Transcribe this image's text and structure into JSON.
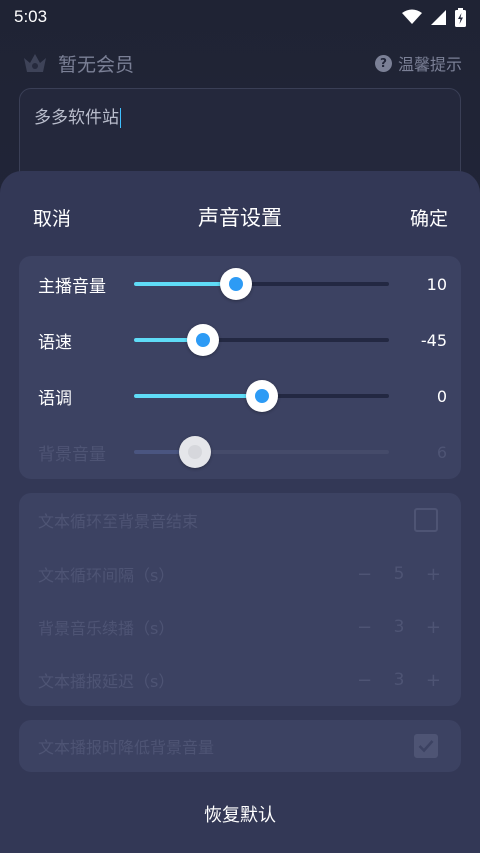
{
  "status_bar": {
    "time": "5:03"
  },
  "background": {
    "vip_label": "暂无会员",
    "tip_label": "温馨提示",
    "text_content": "多多软件站"
  },
  "sheet": {
    "cancel": "取消",
    "title": "声音设置",
    "confirm": "确定",
    "sliders": [
      {
        "label": "主播音量",
        "value_text": "10",
        "fraction": 0.4,
        "enabled": true
      },
      {
        "label": "语速",
        "value_text": "-45",
        "fraction": 0.27,
        "enabled": true
      },
      {
        "label": "语调",
        "value_text": "0",
        "fraction": 0.5,
        "enabled": true
      },
      {
        "label": "背景音量",
        "value_text": "6",
        "fraction": 0.24,
        "enabled": false
      }
    ],
    "loop_to_end": {
      "label": "文本循环至背景音结束",
      "checked": false
    },
    "steppers": [
      {
        "label": "文本循环间隔（s）",
        "minus": "−",
        "value": "5",
        "plus": "+"
      },
      {
        "label": "背景音乐续播（s）",
        "minus": "−",
        "value": "3",
        "plus": "+"
      },
      {
        "label": "文本播报延迟（s）",
        "minus": "−",
        "value": "3",
        "plus": "+"
      }
    ],
    "lower_bg": {
      "label": "文本播报时降低背景音量",
      "checked": true
    },
    "restore": "恢复默认"
  },
  "colors": {
    "accent": "#5fdcf7",
    "thumb_dot": "#2d9bf5",
    "sheet_bg": "#333856",
    "card_bg": "#3c4262",
    "disabled_text": "#4e5474"
  }
}
